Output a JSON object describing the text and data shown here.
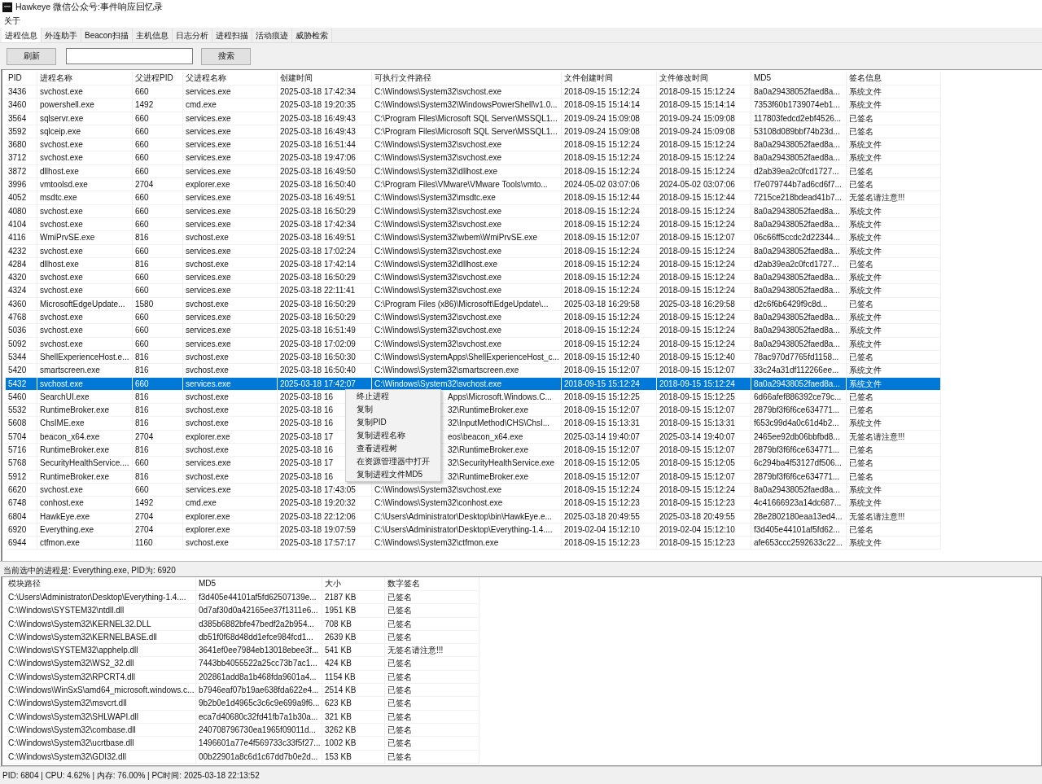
{
  "window": {
    "title": "Hawkeye 微信公众号:事件响应回忆录"
  },
  "menu_bar": [
    "关于"
  ],
  "tabs": [
    {
      "label": "进程信息",
      "selected": true
    },
    {
      "label": "外连助手",
      "selected": false
    },
    {
      "label": "Beacon扫描",
      "selected": false
    },
    {
      "label": "主机信息",
      "selected": false
    },
    {
      "label": "日志分析",
      "selected": false
    },
    {
      "label": "进程扫描",
      "selected": false
    },
    {
      "label": "活动痕迹",
      "selected": false
    },
    {
      "label": "威胁检索",
      "selected": false
    }
  ],
  "toolbar": {
    "refresh_button": "刷新",
    "search_button": "搜索"
  },
  "process_table": {
    "columns": [
      "PID",
      "进程名称",
      "父进程PID",
      "父进程名称",
      "创建时间",
      "可执行文件路径",
      "文件创建时间",
      "文件修改时间",
      "MD5",
      "签名信息"
    ],
    "rows": [
      {
        "cells": [
          "3436",
          "svchost.exe",
          "660",
          "services.exe",
          "2025-03-18 17:42:34",
          "C:\\Windows\\System32\\svchost.exe",
          "2018-09-15 15:12:24",
          "2018-09-15 15:12:24",
          "8a0a29438052faed8a...",
          "系统文件"
        ],
        "selected": false
      },
      {
        "cells": [
          "3460",
          "powershell.exe",
          "1492",
          "cmd.exe",
          "2025-03-18 19:20:35",
          "C:\\Windows\\System32\\WindowsPowerShell\\v1.0...",
          "2018-09-15 15:14:14",
          "2018-09-15 15:14:14",
          "7353f60b1739074eb1...",
          "系统文件"
        ],
        "selected": false
      },
      {
        "cells": [
          "3564",
          "sqlservr.exe",
          "660",
          "services.exe",
          "2025-03-18 16:49:43",
          "C:\\Program Files\\Microsoft SQL Server\\MSSQL1...",
          "2019-09-24 15:09:08",
          "2019-09-24 15:09:08",
          "117803fedcd2ebf4526...",
          "已签名"
        ],
        "selected": false
      },
      {
        "cells": [
          "3592",
          "sqlceip.exe",
          "660",
          "services.exe",
          "2025-03-18 16:49:43",
          "C:\\Program Files\\Microsoft SQL Server\\MSSQL1...",
          "2019-09-24 15:09:08",
          "2019-09-24 15:09:08",
          "53108d089bbf74b23d...",
          "已签名"
        ],
        "selected": false
      },
      {
        "cells": [
          "3680",
          "svchost.exe",
          "660",
          "services.exe",
          "2025-03-18 16:51:44",
          "C:\\Windows\\System32\\svchost.exe",
          "2018-09-15 15:12:24",
          "2018-09-15 15:12:24",
          "8a0a29438052faed8a...",
          "系统文件"
        ],
        "selected": false
      },
      {
        "cells": [
          "3712",
          "svchost.exe",
          "660",
          "services.exe",
          "2025-03-18 19:47:06",
          "C:\\Windows\\System32\\svchost.exe",
          "2018-09-15 15:12:24",
          "2018-09-15 15:12:24",
          "8a0a29438052faed8a...",
          "系统文件"
        ],
        "selected": false
      },
      {
        "cells": [
          "3872",
          "dllhost.exe",
          "660",
          "services.exe",
          "2025-03-18 16:49:50",
          "C:\\Windows\\System32\\dllhost.exe",
          "2018-09-15 15:12:24",
          "2018-09-15 15:12:24",
          "d2ab39ea2c0fcd1727...",
          "已签名"
        ],
        "selected": false
      },
      {
        "cells": [
          "3996",
          "vmtoolsd.exe",
          "2704",
          "explorer.exe",
          "2025-03-18 16:50:40",
          "C:\\Program Files\\VMware\\VMware Tools\\vmto...",
          "2024-05-02 03:07:06",
          "2024-05-02 03:07:06",
          "f7e079744b7ad6cd6f7...",
          "已签名"
        ],
        "selected": false
      },
      {
        "cells": [
          "4052",
          "msdtc.exe",
          "660",
          "services.exe",
          "2025-03-18 16:49:51",
          "C:\\Windows\\System32\\msdtc.exe",
          "2018-09-15 15:12:44",
          "2018-09-15 15:12:44",
          "7215ce218bdead41b7...",
          "无签名请注意!!!"
        ],
        "selected": false
      },
      {
        "cells": [
          "4080",
          "svchost.exe",
          "660",
          "services.exe",
          "2025-03-18 16:50:29",
          "C:\\Windows\\System32\\svchost.exe",
          "2018-09-15 15:12:24",
          "2018-09-15 15:12:24",
          "8a0a29438052faed8a...",
          "系统文件"
        ],
        "selected": false
      },
      {
        "cells": [
          "4104",
          "svchost.exe",
          "660",
          "services.exe",
          "2025-03-18 17:42:34",
          "C:\\Windows\\System32\\svchost.exe",
          "2018-09-15 15:12:24",
          "2018-09-15 15:12:24",
          "8a0a29438052faed8a...",
          "系统文件"
        ],
        "selected": false
      },
      {
        "cells": [
          "4116",
          "WmiPrvSE.exe",
          "816",
          "svchost.exe",
          "2025-03-18 16:49:51",
          "C:\\Windows\\System32\\wbem\\WmiPrvSE.exe",
          "2018-09-15 15:12:07",
          "2018-09-15 15:12:07",
          "06c66ff5ccdc2d22344...",
          "系统文件"
        ],
        "selected": false
      },
      {
        "cells": [
          "4232",
          "svchost.exe",
          "660",
          "services.exe",
          "2025-03-18 17:02:24",
          "C:\\Windows\\System32\\svchost.exe",
          "2018-09-15 15:12:24",
          "2018-09-15 15:12:24",
          "8a0a29438052faed8a...",
          "系统文件"
        ],
        "selected": false
      },
      {
        "cells": [
          "4284",
          "dllhost.exe",
          "816",
          "svchost.exe",
          "2025-03-18 17:42:14",
          "C:\\Windows\\System32\\dllhost.exe",
          "2018-09-15 15:12:24",
          "2018-09-15 15:12:24",
          "d2ab39ea2c0fcd1727...",
          "已签名"
        ],
        "selected": false
      },
      {
        "cells": [
          "4320",
          "svchost.exe",
          "660",
          "services.exe",
          "2025-03-18 16:50:29",
          "C:\\Windows\\System32\\svchost.exe",
          "2018-09-15 15:12:24",
          "2018-09-15 15:12:24",
          "8a0a29438052faed8a...",
          "系统文件"
        ],
        "selected": false
      },
      {
        "cells": [
          "4324",
          "svchost.exe",
          "660",
          "services.exe",
          "2025-03-18 22:11:41",
          "C:\\Windows\\System32\\svchost.exe",
          "2018-09-15 15:12:24",
          "2018-09-15 15:12:24",
          "8a0a29438052faed8a...",
          "系统文件"
        ],
        "selected": false
      },
      {
        "cells": [
          "4360",
          "MicrosoftEdgeUpdate...",
          "1580",
          "svchost.exe",
          "2025-03-18 16:50:29",
          "C:\\Program Files (x86)\\Microsoft\\EdgeUpdate\\...",
          "2025-03-18 16:29:58",
          "2025-03-18 16:29:58",
          "d2c6f6b6429f9c8d...",
          "已签名"
        ],
        "selected": false
      },
      {
        "cells": [
          "4768",
          "svchost.exe",
          "660",
          "services.exe",
          "2025-03-18 16:50:29",
          "C:\\Windows\\System32\\svchost.exe",
          "2018-09-15 15:12:24",
          "2018-09-15 15:12:24",
          "8a0a29438052faed8a...",
          "系统文件"
        ],
        "selected": false
      },
      {
        "cells": [
          "5036",
          "svchost.exe",
          "660",
          "services.exe",
          "2025-03-18 16:51:49",
          "C:\\Windows\\System32\\svchost.exe",
          "2018-09-15 15:12:24",
          "2018-09-15 15:12:24",
          "8a0a29438052faed8a...",
          "系统文件"
        ],
        "selected": false
      },
      {
        "cells": [
          "5092",
          "svchost.exe",
          "660",
          "services.exe",
          "2025-03-18 17:02:09",
          "C:\\Windows\\System32\\svchost.exe",
          "2018-09-15 15:12:24",
          "2018-09-15 15:12:24",
          "8a0a29438052faed8a...",
          "系统文件"
        ],
        "selected": false
      },
      {
        "cells": [
          "5344",
          "ShellExperienceHost.e...",
          "816",
          "svchost.exe",
          "2025-03-18 16:50:30",
          "C:\\Windows\\SystemApps\\ShellExperienceHost_c...",
          "2018-09-15 15:12:40",
          "2018-09-15 15:12:40",
          "78ac970d7765fd1158...",
          "已签名"
        ],
        "selected": false
      },
      {
        "cells": [
          "5420",
          "smartscreen.exe",
          "816",
          "svchost.exe",
          "2025-03-18 16:50:40",
          "C:\\Windows\\System32\\smartscreen.exe",
          "2018-09-15 15:12:07",
          "2018-09-15 15:12:07",
          "33c24a31df112266ee...",
          "系统文件"
        ],
        "selected": false
      },
      {
        "cells": [
          "5432",
          "svchost.exe",
          "660",
          "services.exe",
          "2025-03-18 17:42:07",
          "C:\\Windows\\System32\\svchost.exe",
          "2018-09-15 15:12:24",
          "2018-09-15 15:12:24",
          "8a0a29438052faed8a...",
          "系统文件"
        ],
        "selected": true
      },
      {
        "cells": [
          "5460",
          "SearchUI.exe",
          "816",
          "svchost.exe",
          "2025-03-18 16",
          "Apps\\Microsoft.Windows.C...",
          "2018-09-15 15:12:25",
          "2018-09-15 15:12:25",
          "6d66afef886392ce79c...",
          "已签名"
        ],
        "selected": false
      },
      {
        "cells": [
          "5532",
          "RuntimeBroker.exe",
          "816",
          "svchost.exe",
          "2025-03-18 16",
          "32\\RuntimeBroker.exe",
          "2018-09-15 15:12:07",
          "2018-09-15 15:12:07",
          "2879bf3f6f6ce634771...",
          "已签名"
        ],
        "selected": false
      },
      {
        "cells": [
          "5608",
          "ChsIME.exe",
          "816",
          "svchost.exe",
          "2025-03-18 16",
          "32\\InputMethod\\CHS\\ChsI...",
          "2018-09-15 15:13:31",
          "2018-09-15 15:13:31",
          "f653c99d4a0c61d4b2...",
          "系统文件"
        ],
        "selected": false
      },
      {
        "cells": [
          "5704",
          "beacon_x64.exe",
          "2704",
          "explorer.exe",
          "2025-03-18 17",
          "eos\\beacon_x64.exe",
          "2025-03-14 19:40:07",
          "2025-03-14 19:40:07",
          "2465ee92db06bbfbd8...",
          "无签名请注意!!!"
        ],
        "selected": false
      },
      {
        "cells": [
          "5716",
          "RuntimeBroker.exe",
          "816",
          "svchost.exe",
          "2025-03-18 16",
          "32\\RuntimeBroker.exe",
          "2018-09-15 15:12:07",
          "2018-09-15 15:12:07",
          "2879bf3f6f6ce634771...",
          "已签名"
        ],
        "selected": false
      },
      {
        "cells": [
          "5768",
          "SecurityHealthService....",
          "660",
          "services.exe",
          "2025-03-18 17",
          "32\\SecurityHealthService.exe",
          "2018-09-15 15:12:05",
          "2018-09-15 15:12:05",
          "6c294ba4f53127df506...",
          "已签名"
        ],
        "selected": false
      },
      {
        "cells": [
          "5912",
          "RuntimeBroker.exe",
          "816",
          "svchost.exe",
          "2025-03-18 16",
          "32\\RuntimeBroker.exe",
          "2018-09-15 15:12:07",
          "2018-09-15 15:12:07",
          "2879bf3f6f6ce634771...",
          "已签名"
        ],
        "selected": false
      },
      {
        "cells": [
          "6620",
          "svchost.exe",
          "660",
          "services.exe",
          "2025-03-18 17:43:05",
          "C:\\Windows\\System32\\svchost.exe",
          "2018-09-15 15:12:24",
          "2018-09-15 15:12:24",
          "8a0a29438052faed8a...",
          "系统文件"
        ],
        "selected": false
      },
      {
        "cells": [
          "6748",
          "conhost.exe",
          "1492",
          "cmd.exe",
          "2025-03-18 19:20:32",
          "C:\\Windows\\System32\\conhost.exe",
          "2018-09-15 15:12:23",
          "2018-09-15 15:12:23",
          "4c41666923a14dc687...",
          "系统文件"
        ],
        "selected": false
      },
      {
        "cells": [
          "6804",
          "HawkEye.exe",
          "2704",
          "explorer.exe",
          "2025-03-18 22:12:06",
          "C:\\Users\\Administrator\\Desktop\\bin\\HawkEye.e...",
          "2025-03-18 20:49:55",
          "2025-03-18 20:49:55",
          "28e2802180eaa13ed4...",
          "无签名请注意!!!"
        ],
        "selected": false
      },
      {
        "cells": [
          "6920",
          "Everything.exe",
          "2704",
          "explorer.exe",
          "2025-03-18 19:07:59",
          "C:\\Users\\Administrator\\Desktop\\Everything-1.4....",
          "2019-02-04 15:12:10",
          "2019-02-04 15:12:10",
          "f3d405e44101af5fd62...",
          "已签名"
        ],
        "selected": false
      },
      {
        "cells": [
          "6944",
          "ctfmon.exe",
          "1160",
          "svchost.exe",
          "2025-03-18 17:57:17",
          "C:\\Windows\\System32\\ctfmon.exe",
          "2018-09-15 15:12:23",
          "2018-09-15 15:12:23",
          "afe653ccc2592633c22...",
          "系统文件"
        ],
        "selected": false
      }
    ]
  },
  "context_menu": {
    "items": [
      "终止进程",
      "复制",
      "复制PID",
      "复制进程名称",
      "查看进程树",
      "在资源管理器中打开",
      "复制进程文件MD5"
    ]
  },
  "selected_info": "当前选中的进程是: Everything.exe, PID为: 6920",
  "module_table": {
    "columns": [
      "模块路径",
      "MD5",
      "大小",
      "数字签名"
    ],
    "rows": [
      [
        "C:\\Users\\Administrator\\Desktop\\Everything-1.4....",
        "f3d405e44101af5fd62507139e...",
        "2187 KB",
        "已签名"
      ],
      [
        "C:\\Windows\\SYSTEM32\\ntdll.dll",
        "0d7af30d0a42165ee37f1311e6...",
        "1951 KB",
        "已签名"
      ],
      [
        "C:\\Windows\\System32\\KERNEL32.DLL",
        "d385b6882bfe47bedf2a2b954...",
        "708 KB",
        "已签名"
      ],
      [
        "C:\\Windows\\System32\\KERNELBASE.dll",
        "db51f0f68d48dd1efce984fcd1...",
        "2639 KB",
        "已签名"
      ],
      [
        "C:\\Windows\\SYSTEM32\\apphelp.dll",
        "3641ef0ee7984eb13018ebee3f...",
        "541 KB",
        "无签名请注意!!!"
      ],
      [
        "C:\\Windows\\System32\\WS2_32.dll",
        "7443bb4055522a25cc73b7ac1...",
        "424 KB",
        "已签名"
      ],
      [
        "C:\\Windows\\System32\\RPCRT4.dll",
        "202861add8a1b468fda9601a4...",
        "1154 KB",
        "已签名"
      ],
      [
        "C:\\Windows\\WinSxS\\amd64_microsoft.windows.c...",
        "b7946eaf07b19ae638fda622e4...",
        "2514 KB",
        "已签名"
      ],
      [
        "C:\\Windows\\System32\\msvcrt.dll",
        "9b2b0e1d4965c3c6c9e699a9f6...",
        "623 KB",
        "已签名"
      ],
      [
        "C:\\Windows\\System32\\SHLWAPI.dll",
        "eca7d40680c32fd41fb7a1b30a...",
        "321 KB",
        "已签名"
      ],
      [
        "C:\\Windows\\System32\\combase.dll",
        "240708796730ea1965f09011d...",
        "3262 KB",
        "已签名"
      ],
      [
        "C:\\Windows\\System32\\ucrtbase.dll",
        "1496601a77e4f569733c33f5f27...",
        "1002 KB",
        "已签名"
      ],
      [
        "C:\\Windows\\System32\\GDI32.dll",
        "00b22901a8c6d1c67dd7b0e2d...",
        "153 KB",
        "已签名"
      ]
    ]
  },
  "status_bar": "PID: 6804 | CPU: 4.62% | 内存: 76.00% | PC时间: 2025-03-18 22:13:52"
}
